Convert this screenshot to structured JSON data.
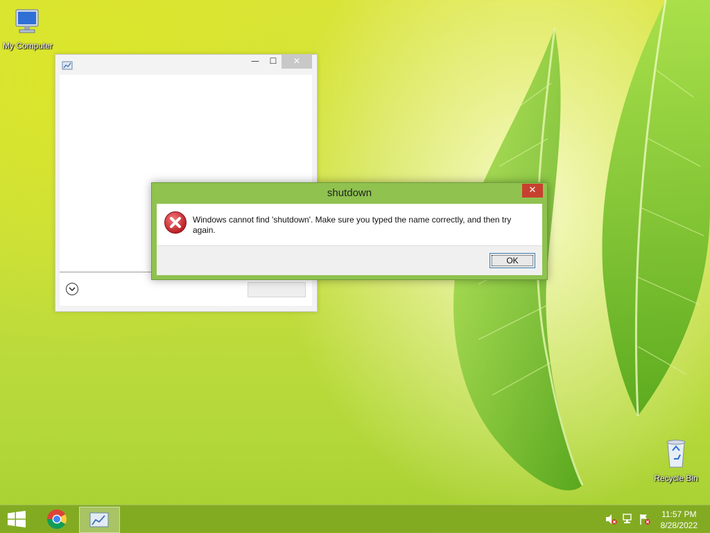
{
  "desktop": {
    "icons": [
      {
        "label": "My Computer"
      },
      {
        "label": "Recycle Bin"
      }
    ]
  },
  "background_window": {
    "min_glyph": "—",
    "max_glyph": "☐",
    "close_glyph": "✕"
  },
  "dialog": {
    "title": "shutdown",
    "close_glyph": "✕",
    "message": "Windows cannot find 'shutdown'. Make sure you typed the name correctly, and then try again.",
    "ok_label": "OK"
  },
  "taskbar": {
    "time": "11:57 PM",
    "date": "8/28/2022"
  },
  "colors": {
    "dialog_frame": "#8fc24f",
    "close_red": "#c7402f",
    "error_red": "#d0202a"
  }
}
